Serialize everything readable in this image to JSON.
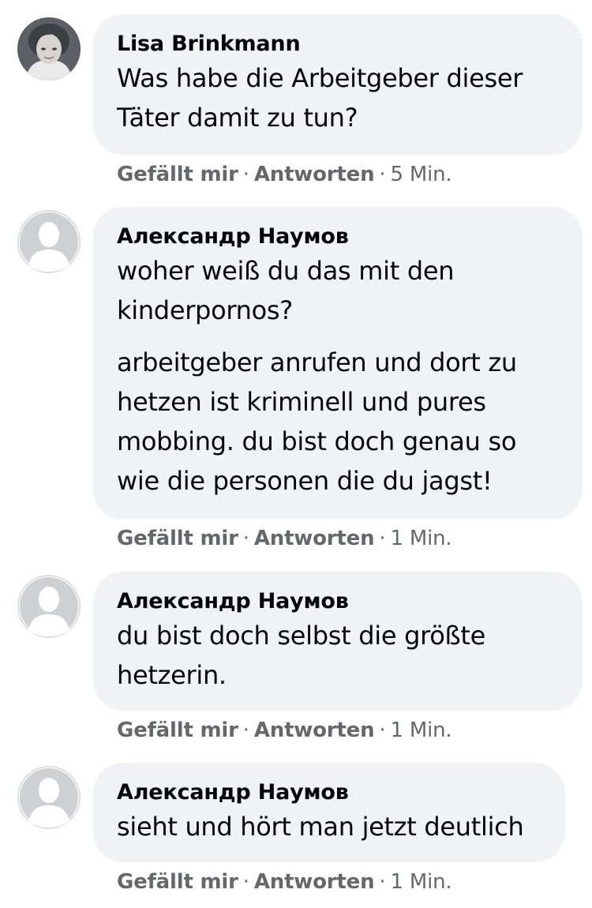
{
  "comments": [
    {
      "author": "Lisa Brinkmann",
      "avatar": "profile-photo",
      "paragraphs": [
        "Was habe die Arbeitgeber dieser Täter damit zu tun?"
      ],
      "lines": [
        [
          "Was habe die Arbeitgeber dieser",
          "Täter damit zu tun?"
        ]
      ],
      "like_label": "Gefällt mir",
      "reply_label": "Antworten",
      "separator": "·",
      "time": "5 Min."
    },
    {
      "author": "Александр Наумов",
      "avatar": "default-user-icon",
      "paragraphs": [
        "woher weiß du das mit den kinderpornos?",
        "arbeitgeber anrufen und dort zu hetzen ist kriminell und pures mobbing. du bist doch genau so wie die personen die du jagst!"
      ],
      "lines": [
        [
          "woher weiß du das mit den",
          "kinderpornos?"
        ],
        [
          "arbeitgeber anrufen und dort zu",
          "hetzen ist kriminell und pures",
          "mobbing. du bist doch genau so",
          "wie die personen die du jagst!"
        ]
      ],
      "like_label": "Gefällt mir",
      "reply_label": "Antworten",
      "separator": "·",
      "time": "1 Min."
    },
    {
      "author": "Александр Наумов",
      "avatar": "default-user-icon",
      "paragraphs": [
        "du bist doch selbst die größte hetzerin."
      ],
      "lines": [
        [
          "du bist doch selbst die größte",
          "hetzerin."
        ]
      ],
      "like_label": "Gefällt mir",
      "reply_label": "Antworten",
      "separator": "·",
      "time": "1 Min."
    },
    {
      "author": "Александр Наумов",
      "avatar": "default-user-icon",
      "paragraphs": [
        "sieht und hört man jetzt deutlich"
      ],
      "lines": [
        [
          "sieht und hört man jetzt deutlich"
        ]
      ],
      "like_label": "Gefällt mir",
      "reply_label": "Antworten",
      "separator": "·",
      "time": "1 Min."
    }
  ],
  "colors": {
    "bubble_background": "#f0f2f5",
    "text": "#050505",
    "secondary_text": "#65676b",
    "avatar_placeholder": "#ced0d4"
  }
}
